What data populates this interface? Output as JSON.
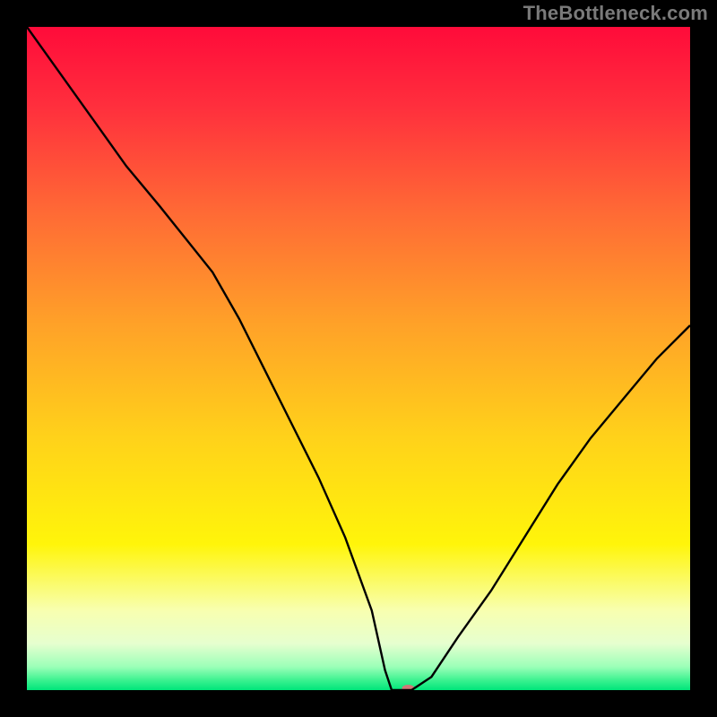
{
  "watermark": "TheBottleneck.com",
  "chart_data": {
    "type": "line",
    "title": "",
    "xlabel": "",
    "ylabel": "",
    "xlim": [
      0,
      100
    ],
    "ylim": [
      0,
      100
    ],
    "grid": false,
    "background": {
      "type": "vertical-gradient",
      "stops": [
        {
          "pos": 0.0,
          "color": "#ff0b3a"
        },
        {
          "pos": 0.12,
          "color": "#ff2f3d"
        },
        {
          "pos": 0.28,
          "color": "#ff6a35"
        },
        {
          "pos": 0.45,
          "color": "#ffa228"
        },
        {
          "pos": 0.62,
          "color": "#ffd21a"
        },
        {
          "pos": 0.78,
          "color": "#fff50a"
        },
        {
          "pos": 0.88,
          "color": "#f8ffb0"
        },
        {
          "pos": 0.93,
          "color": "#e6ffcf"
        },
        {
          "pos": 0.965,
          "color": "#9bffb8"
        },
        {
          "pos": 0.985,
          "color": "#3cf290"
        },
        {
          "pos": 1.0,
          "color": "#00e57a"
        }
      ]
    },
    "series": [
      {
        "name": "bottleneck-curve",
        "color": "#000000",
        "x": [
          0,
          5,
          10,
          15,
          20,
          24,
          28,
          32,
          36,
          40,
          44,
          48,
          52,
          54,
          55,
          56,
          58,
          61,
          65,
          70,
          75,
          80,
          85,
          90,
          95,
          100
        ],
        "y": [
          100,
          93,
          86,
          79,
          73,
          68,
          63,
          56,
          48,
          40,
          32,
          23,
          12,
          3,
          0,
          0,
          0,
          2,
          8,
          15,
          23,
          31,
          38,
          44,
          50,
          55
        ]
      }
    ],
    "marker": {
      "name": "optimal-point",
      "x": 57.5,
      "y": 0,
      "color": "#d07878",
      "rx": 7,
      "ry": 4
    }
  }
}
